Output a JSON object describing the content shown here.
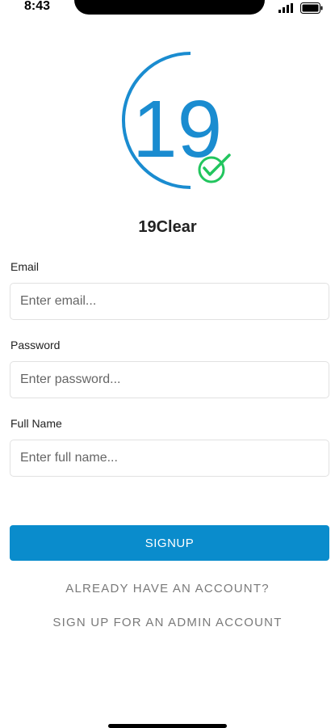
{
  "status_bar": {
    "time": "8:43",
    "signal_icon": "signal-bars-icon",
    "battery_icon": "battery-icon"
  },
  "logo": {
    "number": "19",
    "check_icon": "check-circle-icon",
    "ring_color": "#1a8cd0",
    "check_color": "#22c55e"
  },
  "app_name": "19Clear",
  "form": {
    "email": {
      "label": "Email",
      "placeholder": "Enter email...",
      "value": ""
    },
    "password": {
      "label": "Password",
      "placeholder": "Enter password...",
      "value": ""
    },
    "full_name": {
      "label": "Full Name",
      "placeholder": "Enter full name...",
      "value": ""
    }
  },
  "buttons": {
    "signup": "SIGNUP"
  },
  "links": {
    "have_account": "ALREADY HAVE AN ACCOUNT?",
    "admin_signup": "SIGN UP FOR AN ADMIN ACCOUNT"
  },
  "colors": {
    "accent": "#0a8ccc",
    "link_text": "#7a7a7a"
  }
}
